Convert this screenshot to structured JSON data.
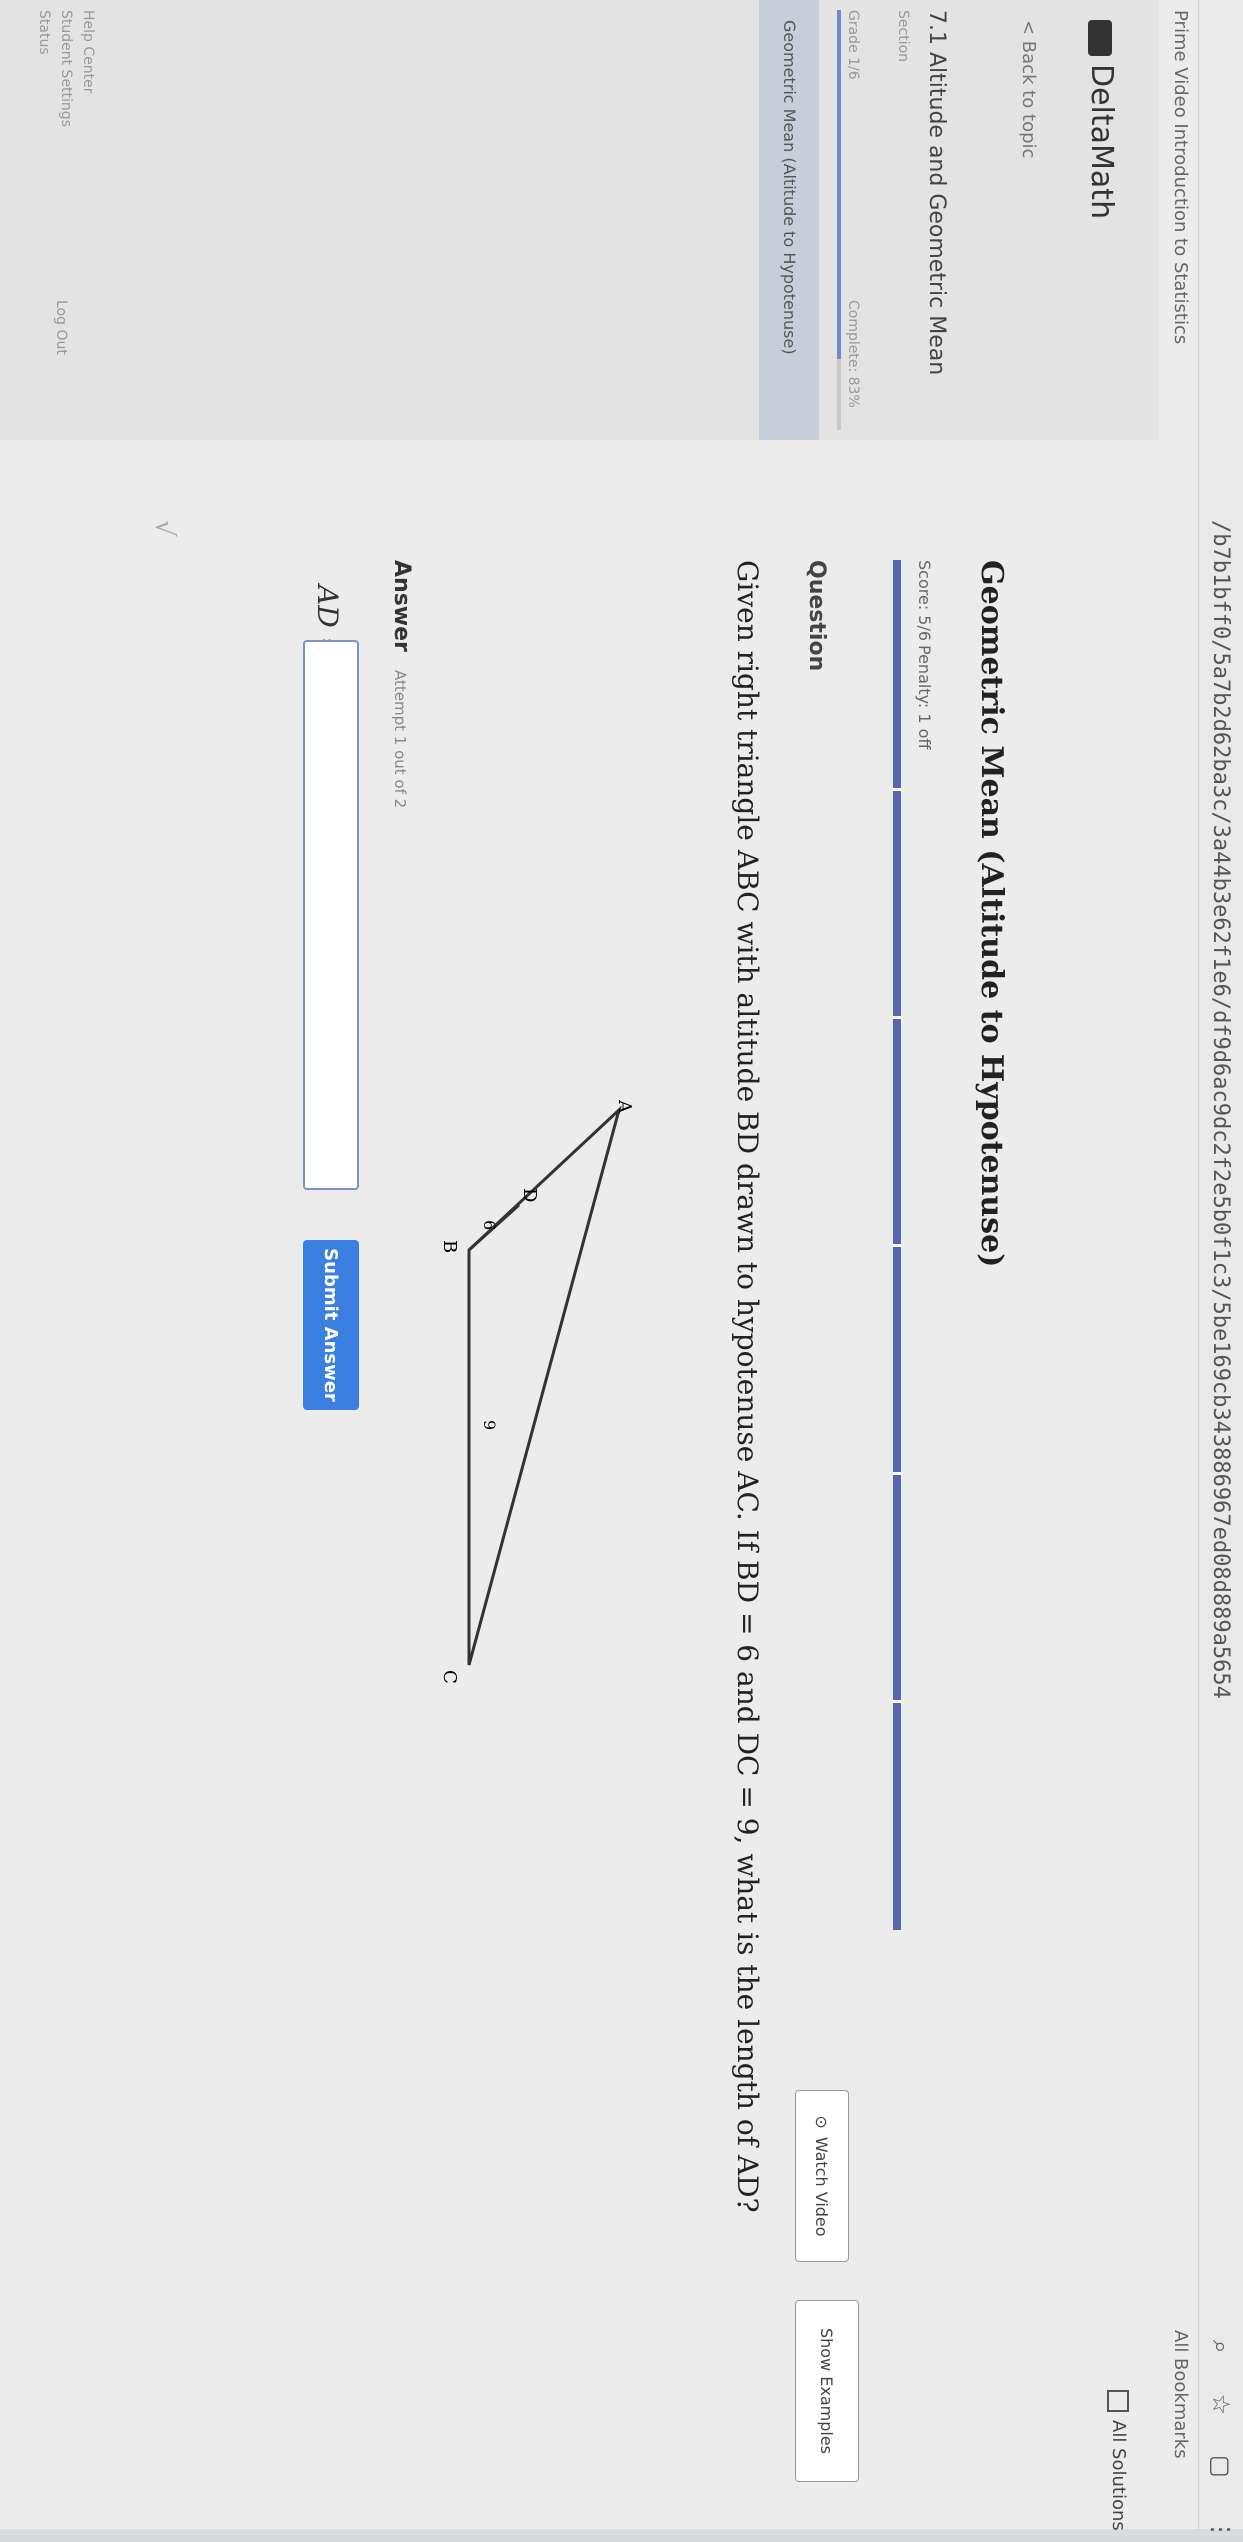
{
  "browser": {
    "url": "/b7b1bff0/5a7b2d62ba3c/3a44b3e62f1e6/df9d6ac9dc2f2e5b0f1c3/5be169cb343886967ed08d889a5654",
    "bookmarks_left": "Prime Video  Introduction to Statistics",
    "bookmarks_right": "All Bookmarks"
  },
  "sidebar": {
    "brand": "DeltaMath",
    "back_label": "< Back to topic",
    "topic_title": "7.1 Altitude and Geometric Mean",
    "topic_sub": "Section",
    "grade": "Grade 1/6",
    "complete": "Complete: 83%",
    "progress_percent": 83,
    "active_item": "Geometric Mean (Altitude to Hypotenuse)",
    "bottom_links": "Help Center\nStudent Settings\nStatus",
    "logout": "Log Out"
  },
  "main": {
    "all_solutions_label": "All Solutions",
    "lesson_title": "Geometric Mean (Altitude to Hypotenuse)",
    "score": "Score: 5/6",
    "penalty": "Penalty: 1 off",
    "question_label": "Question",
    "watch_video": "Watch Video",
    "show_examples": "Show Examples",
    "question_text": "Given right triangle ABC with altitude BD drawn to hypotenuse AC. If BD = 6 and DC = 9, what is the length of AD?",
    "answer_label": "Answer",
    "attempt": "Attempt 1 out of 2",
    "ad_label": "AD =",
    "answer_placeholder": "",
    "submit": "Submit Answer"
  },
  "diagram": {
    "labels": {
      "A": "A",
      "B": "B",
      "C": "C",
      "D": "D",
      "bd": "6",
      "dc": "9"
    }
  },
  "colors": {
    "accent": "#5767ad",
    "submit": "#3b7fe0"
  }
}
